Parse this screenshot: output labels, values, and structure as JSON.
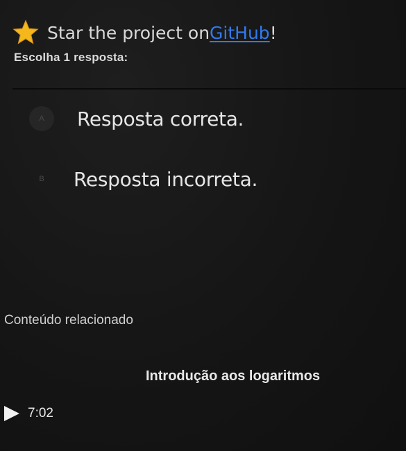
{
  "banner": {
    "icon": "star-icon",
    "prefix": "Star the project on ",
    "link_text": "GitHub",
    "suffix": "!",
    "link_color": "#2f7bf0",
    "star_color": "#f5b81c"
  },
  "question": {
    "instruction": "Escolha 1 resposta:",
    "options": [
      {
        "letter": "A",
        "text": "Resposta correta."
      },
      {
        "letter": "B",
        "text": "Resposta incorreta."
      }
    ]
  },
  "related": {
    "heading": "Conteúdo relacionado",
    "items": [
      {
        "title": "Introdução aos logaritmos",
        "duration": "7:02",
        "icon": "play-icon"
      }
    ]
  }
}
